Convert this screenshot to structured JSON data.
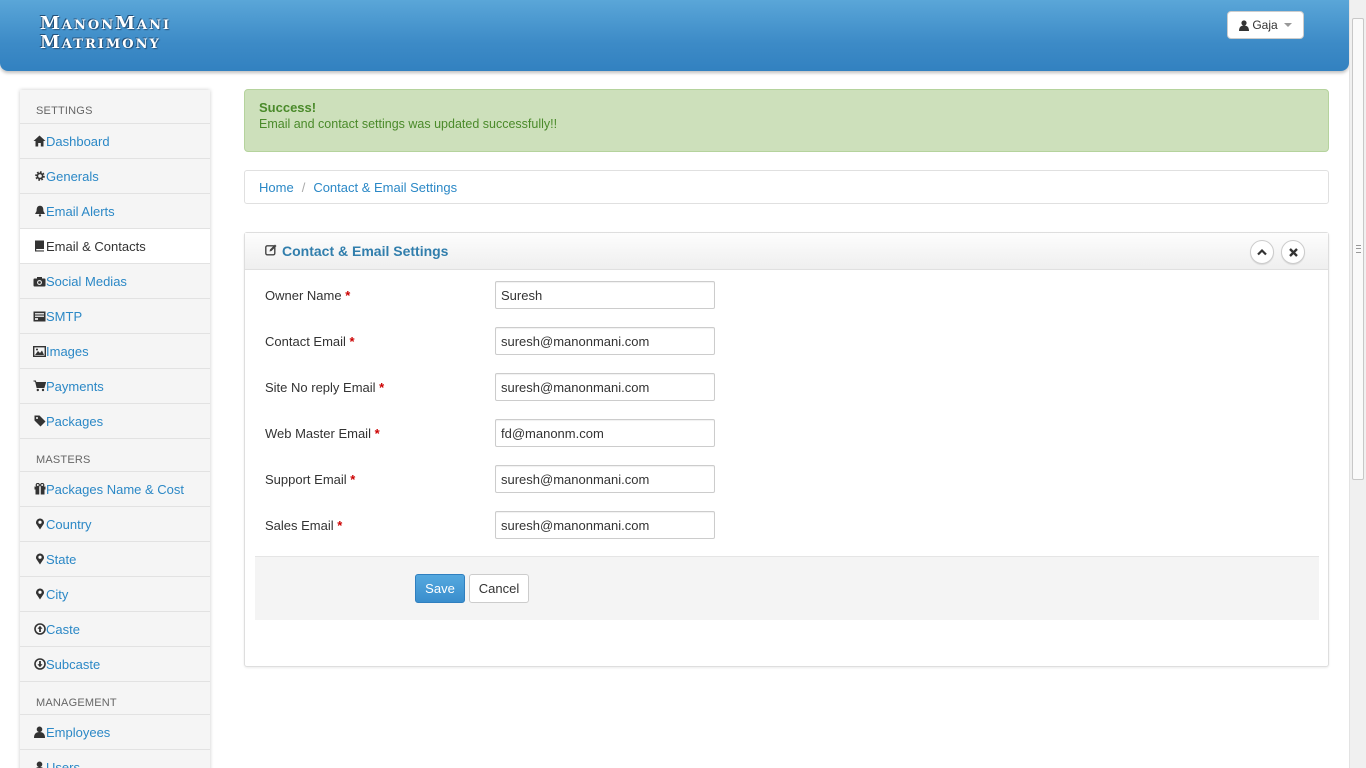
{
  "header": {
    "logo_line1": "ManonMani",
    "logo_line2": "Matrimony",
    "user_name": "Gaja"
  },
  "sidebar": {
    "sections": {
      "settings": "SETTINGS",
      "masters": "MASTERS",
      "management": "MANAGEMENT"
    },
    "settings_items": [
      {
        "label": "Dashboard",
        "icon": "home-icon"
      },
      {
        "label": "Generals",
        "icon": "gear-icon"
      },
      {
        "label": "Email Alerts",
        "icon": "bell-icon"
      },
      {
        "label": "Email & Contacts",
        "icon": "book-icon",
        "active": true
      },
      {
        "label": "Social Medias",
        "icon": "camera-icon"
      },
      {
        "label": "SMTP",
        "icon": "server-icon"
      },
      {
        "label": "Images",
        "icon": "picture-icon"
      },
      {
        "label": "Payments",
        "icon": "cart-icon"
      },
      {
        "label": "Packages",
        "icon": "tag-icon"
      }
    ],
    "masters_items": [
      {
        "label": "Packages Name & Cost",
        "icon": "gift-icon"
      },
      {
        "label": "Country",
        "icon": "map-marker-icon"
      },
      {
        "label": "State",
        "icon": "map-marker-icon"
      },
      {
        "label": "City",
        "icon": "map-marker-icon"
      },
      {
        "label": "Caste",
        "icon": "circle-arrow-up-icon"
      },
      {
        "label": "Subcaste",
        "icon": "circle-arrow-down-icon"
      }
    ],
    "management_items": [
      {
        "label": "Employees",
        "icon": "user-icon"
      },
      {
        "label": "Users",
        "icon": "user-icon"
      }
    ]
  },
  "alert": {
    "title": "Success!",
    "message": "Email and contact settings was updated successfully!!"
  },
  "breadcrumb": {
    "home": "Home",
    "separator": "/",
    "current": "Contact & Email Settings"
  },
  "panel": {
    "title": "Contact & Email Settings"
  },
  "form": {
    "required_mark": "*",
    "fields": [
      {
        "label": "Owner Name",
        "value": "Suresh"
      },
      {
        "label": "Contact Email",
        "value": "suresh@manonmani.com"
      },
      {
        "label": "Site No reply Email",
        "value": "suresh@manonmani.com"
      },
      {
        "label": "Web Master Email",
        "value": "fd@manonm.com"
      },
      {
        "label": "Support Email",
        "value": "suresh@manonmani.com"
      },
      {
        "label": "Sales Email",
        "value": "suresh@manonmani.com"
      }
    ],
    "save_label": "Save",
    "cancel_label": "Cancel"
  },
  "colors": {
    "header_blue": "#3d8bc7",
    "link_blue": "#2b88c6",
    "success_bg": "#cde0bb",
    "success_text": "#4a8a2a",
    "save_button": "#3a8ecd"
  }
}
